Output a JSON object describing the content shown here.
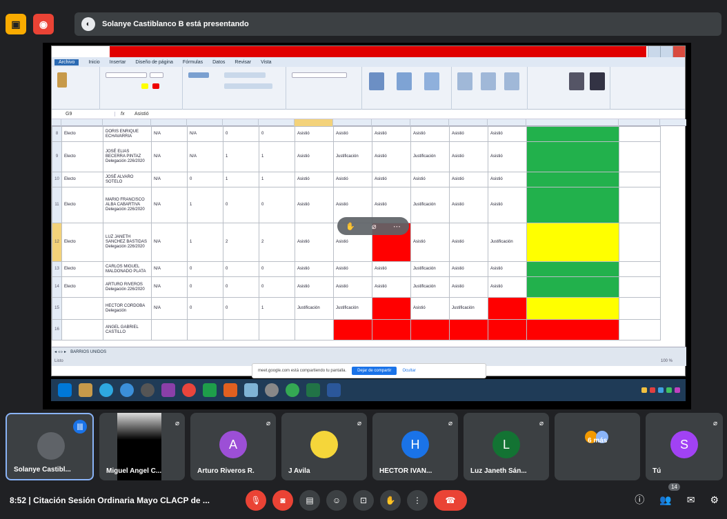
{
  "presenting_banner": "Solanye Castiblanco B está presentando",
  "excel": {
    "ribbon_tabs": [
      "Archivo",
      "Inicio",
      "Insertar",
      "Diseño de página",
      "Fórmulas",
      "Datos",
      "Revisar",
      "Vista"
    ],
    "namebox": "G9",
    "formula_value": "Asistió",
    "rows": [
      {
        "rownum": "8",
        "a": "Electo",
        "b": "DORIS ENRIQUE ECHAVARRIA",
        "c": "N/A",
        "d": "N/A",
        "e": "0",
        "f": "0",
        "cells": [
          "Asistió",
          "Asistió",
          "Asistió",
          "Asistió",
          "Asistió",
          "Asistió"
        ],
        "status": "green",
        "reds": []
      },
      {
        "rownum": "9",
        "a": "Electo",
        "b": "JOSÉ ELIAS BECERRA PINTAZ Delegación 226/2020",
        "c": "N/A",
        "d": "N/A",
        "e": "1",
        "f": "1",
        "cells": [
          "Asistió",
          "Justificación",
          "Asistió",
          "Justificación",
          "Asistió",
          "Asistió"
        ],
        "status": "green",
        "reds": []
      },
      {
        "rownum": "10",
        "a": "Electo",
        "b": "JOSÉ ALVARO SOTELO",
        "c": "N/A",
        "d": "0",
        "e": "1",
        "f": "1",
        "cells": [
          "Asistió",
          "Asistió",
          "Asistió",
          "Asistió",
          "Asistió",
          "Asistió"
        ],
        "status": "green",
        "reds": []
      },
      {
        "rownum": "11",
        "a": "Electo",
        "b": "MARIO FRANCISCO ALBA CABARTIVA Delegación 226/2020",
        "c": "N/A",
        "d": "1",
        "e": "0",
        "f": "0",
        "cells": [
          "Asistió",
          "Asistió",
          "Asistió",
          "Justificación",
          "Asistió",
          "Asistió"
        ],
        "status": "green",
        "reds": []
      },
      {
        "rownum": "12",
        "a": "Electo",
        "b": "LUZ JANETH SANCHEZ BASTIDAS Delegación 226/2020",
        "c": "N/A",
        "d": "1",
        "e": "2",
        "f": "2",
        "cells": [
          "Asistió",
          "Asistió",
          "Ausente",
          "Asistió",
          "Asistió",
          "Justificación"
        ],
        "status": "yellow",
        "reds": [
          2
        ]
      },
      {
        "rownum": "13",
        "a": "Electo",
        "b": "CARLOS MIGUEL MALDONADO PLATA",
        "c": "N/A",
        "d": "0",
        "e": "0",
        "f": "0",
        "cells": [
          "Asistió",
          "Asistió",
          "Asistió",
          "Justificación",
          "Asistió",
          "Asistió"
        ],
        "status": "green",
        "reds": []
      },
      {
        "rownum": "14",
        "a": "Electo",
        "b": "ARTURO RIVEROS Delegación 226/2020",
        "c": "N/A",
        "d": "0",
        "e": "0",
        "f": "0",
        "cells": [
          "Asistió",
          "Asistió",
          "Asistió",
          "Justificación",
          "Asistió",
          "Asistió"
        ],
        "status": "green",
        "reds": []
      },
      {
        "rownum": "15",
        "a": "",
        "b": "HECTOR CORDOBA Delegación",
        "c": "N/A",
        "d": "0",
        "e": "0",
        "f": "1",
        "cells": [
          "Justificación",
          "Justificación",
          "Ausente",
          "Asistió",
          "Justificación",
          "Ausente"
        ],
        "status": "yellow",
        "reds": [
          2,
          5
        ]
      },
      {
        "rownum": "16",
        "a": "",
        "b": "ANGEL GABRIEL CASTILLO",
        "c": "",
        "d": "",
        "e": "",
        "f": "",
        "cells": [
          "",
          "",
          "",
          "",
          "",
          ""
        ],
        "status": "red",
        "reds": [
          1,
          2,
          3,
          4,
          5
        ]
      }
    ],
    "sheet_tabs": "BARRIOS UNIDOS",
    "status_left": "Listo",
    "zoom": "100 %"
  },
  "chrome_share": {
    "text": "meet.google.com está compartiendo tu pantalla.",
    "stop": "Dejar de compartir",
    "hide": "Ocultar"
  },
  "taskbar_time": "9:52",
  "participants": [
    {
      "name": "Solanye Castibl...",
      "initial": "",
      "color": "#5f6368",
      "speaking": true
    },
    {
      "name": "Miguel Angel C...",
      "initial": "",
      "color": "#000000"
    },
    {
      "name": "Arturo Riveros R.",
      "initial": "A",
      "color": "#9c4fd6"
    },
    {
      "name": "J Avila",
      "initial": "",
      "color": "#3c4043"
    },
    {
      "name": "HECTOR IVAN...",
      "initial": "H",
      "color": "#1a73e8"
    },
    {
      "name": "Luz Janeth Sán...",
      "initial": "L",
      "color": "#137333"
    },
    {
      "name": "6 más",
      "initial": "",
      "color": "#3c4043"
    },
    {
      "name": "Tú",
      "initial": "S",
      "color": "#a142f4"
    }
  ],
  "meeting": {
    "time": "8:52",
    "separator": "|",
    "title": "Citación Sesión Ordinaria Mayo CLACP de ..."
  },
  "people_count": "14",
  "colors": {
    "accent": "#1a73e8",
    "danger": "#ea4335",
    "green": "#22b14c",
    "yellow": "#ffff00",
    "red": "#ff0000"
  }
}
